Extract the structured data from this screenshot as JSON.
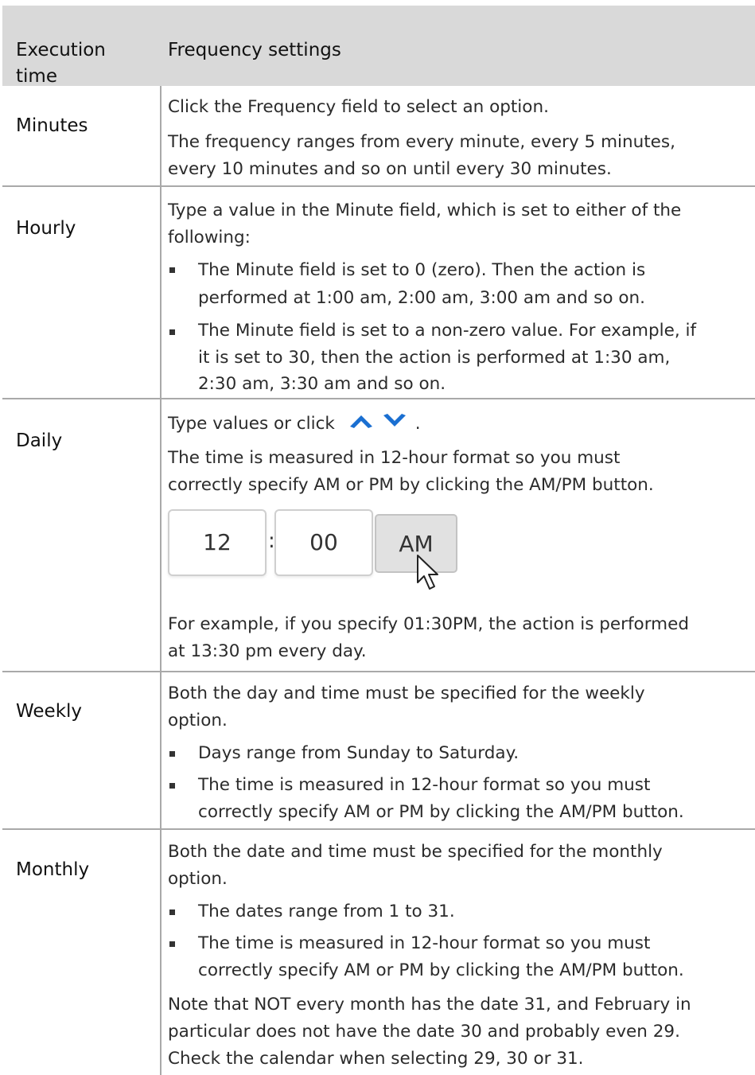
{
  "header": {
    "col1": "Execution time",
    "col2": "Frequency settings"
  },
  "rows": {
    "minutes": {
      "label": "Minutes",
      "p1": "Click the Frequency field to select an option.",
      "p2a": "The frequency ranges from every minute, every 5 minutes,",
      "p2b": "every 10 minutes and so on until every 30 minutes."
    },
    "hourly": {
      "label": "Hourly",
      "p1a": "Type a value in the Minute field, which is set to either of the",
      "p1b": "following:",
      "b1a": "The Minute field is set to 0 (zero). Then the action is",
      "b1b": "performed at 1:00 am, 2:00 am, 3:00 am and so on.",
      "b2a": "The Minute field is set to a non-zero value. For example, if",
      "b2b": "it is set to 30, then the action is performed at 1:30 am,",
      "b2c": "2:30 am, 3:30 am and so on."
    },
    "daily": {
      "label": "Daily",
      "p1": "Type values or click",
      "p1_end": ".",
      "p2a": "The time is measured in 12-hour format so you must",
      "p2b": "correctly specify AM or PM by clicking the AM/PM button.",
      "widget": {
        "hour": "12",
        "colon": ":",
        "minute": "00",
        "ampm": "AM"
      },
      "p3a": "For example, if you specify 01:30PM, the action is performed",
      "p3b": "at 13:30 pm every day.",
      "icons": [
        "chevron-up-icon",
        "chevron-down-icon",
        "mouse-pointer-icon"
      ],
      "icon_color": "#1a6fd1"
    },
    "weekly": {
      "label": "Weekly",
      "p1a": "Both the day and time must be specified for the weekly",
      "p1b": "option.",
      "b1": "Days range from Sunday to Saturday.",
      "b2a": "The time is measured in 12-hour format so you must",
      "b2b": "correctly specify AM or PM by clicking the AM/PM button."
    },
    "monthly": {
      "label": "Monthly",
      "p1a": "Both the date and time must be specified for the monthly",
      "p1b": "option.",
      "b1": "The dates range from 1 to 31.",
      "b2a": "The time is measured in 12-hour format so you must",
      "b2b": "correctly specify AM or PM by clicking the AM/PM button.",
      "n1": "Note that NOT every month has the date 31, and February in",
      "n2": "particular does not have the date 30 and probably even 29.",
      "n3": "Check the calendar when selecting 29, 30 or 31."
    }
  },
  "colors": {
    "header_bg": "#d9d9d9",
    "grid": "#a9a9a9",
    "accent_icon": "#1a6fd1"
  }
}
